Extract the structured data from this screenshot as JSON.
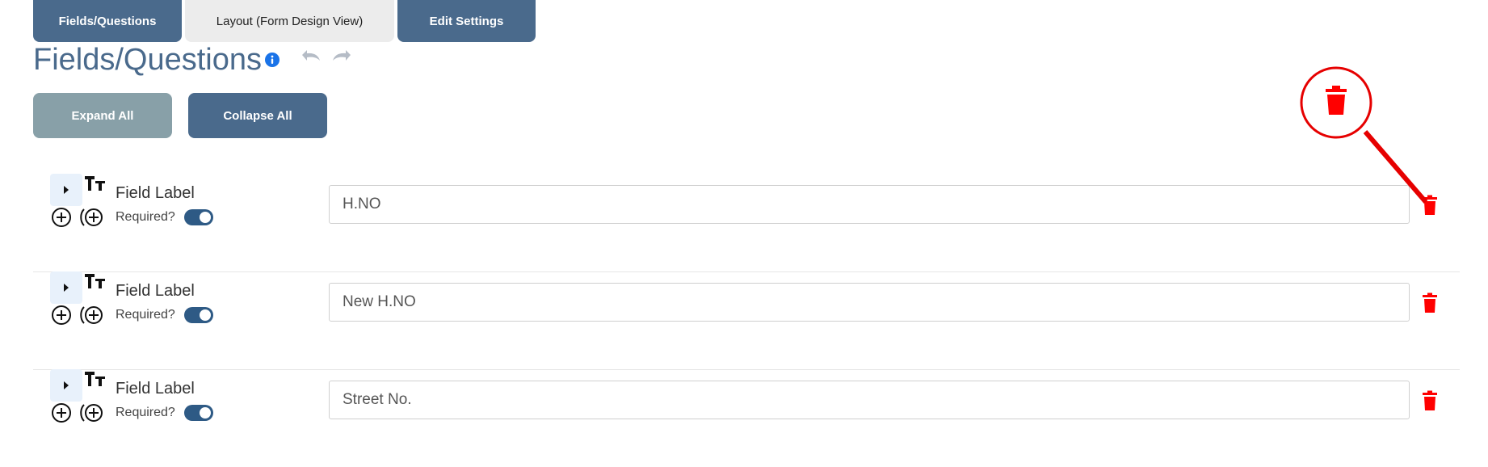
{
  "tabs": [
    {
      "label": "Fields/Questions",
      "active": false
    },
    {
      "label": "Layout (Form Design View)",
      "active": true
    },
    {
      "label": "Edit Settings",
      "active": false
    }
  ],
  "page": {
    "title": "Fields/Questions",
    "info_icon": "info-icon",
    "undo_icon": "undo-icon",
    "redo_icon": "redo-icon"
  },
  "buttons": {
    "expand_all": "Expand All",
    "collapse_all": "Collapse All"
  },
  "rows": [
    {
      "field_label": "Field Label",
      "required_label": "Required?",
      "required": true,
      "value": "H.NO"
    },
    {
      "field_label": "Field Label",
      "required_label": "Required?",
      "required": true,
      "value": "New H.NO"
    },
    {
      "field_label": "Field Label",
      "required_label": "Required?",
      "required": true,
      "value": "Street No."
    }
  ],
  "colors": {
    "primary": "#4a6a8c",
    "expand_button": "#88a0a8",
    "active_tab": "#ececec",
    "toggle_on": "#2e5a85",
    "delete": "#ff0000",
    "callout": "#e60000"
  }
}
